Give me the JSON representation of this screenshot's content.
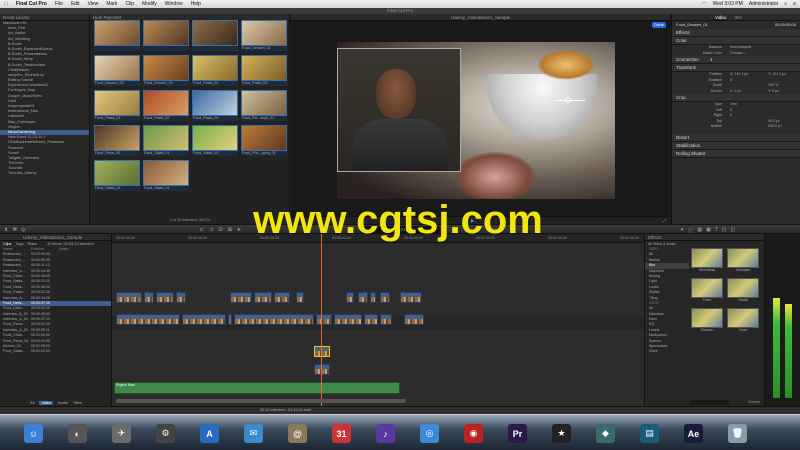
{
  "menubar": {
    "apple_icon": "apple-logo",
    "items": [
      "Final Cut Pro",
      "File",
      "Edit",
      "View",
      "Mark",
      "Clip",
      "Modify",
      "Window",
      "Help"
    ],
    "clock": "Wed 3:03 PM",
    "user": "Administrator"
  },
  "window": {
    "title": "Final Cut Pro"
  },
  "library": {
    "header": "Event Library",
    "items": [
      "Macintosh HD",
      "Alvin_Pett",
      "Art_Wallet",
      "Art_Wedding",
      "B-South",
      "B-South_ExpandedVideos",
      "B-South_Presentations",
      "B-South_Wrap",
      "B-South_Testimonials",
      "Chrafyfianes",
      "campfire_ShortsDrop",
      "Editing Tutorial",
      "ExperienceColumbus01",
      "FortHayes_Map",
      "Gospel_MusicVideo",
      "Hold",
      "Inappropriate01",
      "Instructional_Man",
      "LatitudeIt",
      "Map_FortHayes",
      "Meglen",
      "MicroGardening",
      "New Event 11-15-14-1",
      "OhioBusinessNetwork_Feedback",
      "Pewnoot",
      "Sonali",
      "Tailgate_Outreach",
      "TheDolor",
      "Tutorials",
      "Tutorials_Udemy"
    ],
    "selected_index": 21
  },
  "browser": {
    "header": "Hide Rejected",
    "status": "1 of 45 selected, 40:47s",
    "thumbs": [
      {
        "cap": "",
        "c1": "#c9a36b",
        "c2": "#6e4a2e"
      },
      {
        "cap": "",
        "c1": "#b98b54",
        "c2": "#523623"
      },
      {
        "cap": "",
        "c1": "#8f6d4a",
        "c2": "#3a2a1e"
      },
      {
        "cap": "Food_Dessert_01",
        "c1": "#d9c8a8",
        "c2": "#8a6a4a"
      },
      {
        "cap": "Food_Dessert_02",
        "c1": "#e2d3b5",
        "c2": "#9a7448"
      },
      {
        "cap": "Food_Dessert_03",
        "c1": "#c78a46",
        "c2": "#6a3f1e"
      },
      {
        "cap": "Food_Pasta_01",
        "c1": "#d8c06a",
        "c2": "#8a6a2a"
      },
      {
        "cap": "Food_Pasta_02",
        "c1": "#d4b25a",
        "c2": "#7a5e2a"
      },
      {
        "cap": "Food_Pasta_03",
        "c1": "#e0c880",
        "c2": "#a07a3a"
      },
      {
        "cap": "Food_Pasta_03",
        "c1": "#b04a2a",
        "c2": "#d9a060"
      },
      {
        "cap": "Food_Pasta_04",
        "c1": "#3a6aa0",
        "c2": "#c0d0e0"
      },
      {
        "cap": "Food_Piz...ough_01",
        "c1": "#d0c0a0",
        "c2": "#7a6040"
      },
      {
        "cap": "Food_Pizza_05",
        "c1": "#4a3a2a",
        "c2": "#d0a060"
      },
      {
        "cap": "Food_Salad_01",
        "c1": "#6a9a4a",
        "c2": "#d0c070"
      },
      {
        "cap": "Food_Salad_02",
        "c1": "#7ab04a",
        "c2": "#e0d080"
      },
      {
        "cap": "Food_Pho...ppng_01",
        "c1": "#c07a3a",
        "c2": "#5a3a20"
      },
      {
        "cap": "Food_Salad_03",
        "c1": "#a0b060",
        "c2": "#5a7030"
      },
      {
        "cap": "Food_Salad_04",
        "c1": "#8a5a3a",
        "c2": "#d0b080"
      }
    ]
  },
  "viewer": {
    "header": "Udemy_VideoBasics_Sample",
    "done_label": "Done",
    "zoom": "53%"
  },
  "inspector": {
    "clip_name": "Food_Dessert_01",
    "tabs": [
      "Video",
      "Info"
    ],
    "timecode": "00:00:00:00",
    "sections": {
      "effects": "Effects",
      "color": "Color",
      "connection": "Connection",
      "transform": "Transform",
      "crop": "Crop",
      "distort": "Distort",
      "stabilization": "Stabilization",
      "rolling_shutter": "Rolling Shutter"
    },
    "color_rows": [
      {
        "label": "Balance",
        "val": "Not Analyzed"
      },
      {
        "label": "Match Color",
        "val": "Choose..."
      }
    ],
    "transform_rows": [
      {
        "label": "Position",
        "val": "X: 140.1 px",
        "val2": "Y: 121.2 px"
      },
      {
        "label": "Rotation",
        "val": "0°"
      },
      {
        "label": "Scale",
        "val": "",
        "val2": "100 %"
      },
      {
        "label": "Anchor",
        "val": "X: 0 px",
        "val2": "Y: 0 px"
      }
    ],
    "crop_rows": [
      {
        "label": "Type",
        "val": "Trim"
      },
      {
        "label": "Left",
        "val": "0"
      },
      {
        "label": "Right",
        "val": "0"
      },
      {
        "label": "Top",
        "val": "",
        "val2": "00.0 px"
      },
      {
        "label": "Bottom",
        "val": "",
        "val2": "234.0 px"
      }
    ],
    "connection_val": "1"
  },
  "timeline": {
    "project_name": "Udemy_VideoBasics_Sample",
    "ruler": [
      "00:00:00:00",
      "00:00:15:00",
      "00:00:30:00",
      "00:00:45:00",
      "00:01:00:00",
      "00:01:15:00",
      "00:01:30:00",
      "00:01:45:00"
    ],
    "audio_label": "Rhythm Bass",
    "status": "00:12 selected - 01:42:04 total"
  },
  "index": {
    "tabs": [
      "Clips",
      "Tags",
      "Roles"
    ],
    "summary": "32 items, 00:03:13 selected",
    "col_name": "Name",
    "col_pos": "Position",
    "col_notes": "Notes",
    "rows": [
      {
        "name": "Restaurant_...",
        "pos": "00:00:00:00"
      },
      {
        "name": "Restaurant_...",
        "pos": "00:00:05:05"
      },
      {
        "name": "Restaurant_...",
        "pos": "00:00:11:12"
      },
      {
        "name": "Interview_A...",
        "pos": "00:00:14:09"
      },
      {
        "name": "Food_Chick...",
        "pos": "00:00:18:05"
      },
      {
        "name": "Food_Salad...",
        "pos": "00:00:23:10"
      },
      {
        "name": "Food_Dess...",
        "pos": "00:00:28:05"
      },
      {
        "name": "Food_Pasta...",
        "pos": "00:00:31:20"
      },
      {
        "name": "Interview_A...",
        "pos": "00:00:34:06"
      },
      {
        "name": "Food_Dess...",
        "pos": "00:00:37:15"
      },
      {
        "name": "Food_Dess...",
        "pos": "00:00:41:10"
      },
      {
        "name": "Interview_B_02",
        "pos": "00:00:45:00"
      },
      {
        "name": "Interview_A_03",
        "pos": "00:00:47:10"
      },
      {
        "name": "Food_Pizza...",
        "pos": "00:00:52:05"
      },
      {
        "name": "Interview_A_03",
        "pos": "00:00:55:11"
      },
      {
        "name": "Food_Chick...",
        "pos": "00:01:00:02"
      },
      {
        "name": "Food_Pizza_04",
        "pos": "00:01:04:05"
      },
      {
        "name": "Kitchen_01",
        "pos": "00:01:08:00"
      },
      {
        "name": "Food_Salad...",
        "pos": "00:01:12:00"
      }
    ],
    "selected_index": 9,
    "filter_tabs": [
      "All",
      "Video",
      "Audio",
      "Titles"
    ]
  },
  "effects": {
    "header": "Effects",
    "sub": "All Video & Audio",
    "categories": [
      "VIDEO",
      "All",
      "Basics",
      "Blur",
      "Distortion",
      "Keying",
      "Light",
      "Looks",
      "Stylize",
      "Tiling",
      "AUDIO",
      "All",
      "Distortion",
      "Echo",
      "EQ",
      "Levels",
      "Modulation",
      "Spaces",
      "Specialized",
      "Voice"
    ],
    "selected_index": 3,
    "items": [
      "Directional",
      "Gaussian",
      "Prism",
      "Radial",
      "Sharpen",
      "Zoom"
    ],
    "count": "6 items"
  },
  "dock": {
    "icons": [
      {
        "name": "finder",
        "bg": "#3c7fd6",
        "g": "☺"
      },
      {
        "name": "dashboard",
        "bg": "#555",
        "g": "◐"
      },
      {
        "name": "launchpad",
        "bg": "#6b6b6b",
        "g": "✈"
      },
      {
        "name": "system",
        "bg": "#444",
        "g": "⚙"
      },
      {
        "name": "app-store",
        "bg": "#2a6bc2",
        "g": "A"
      },
      {
        "name": "mail",
        "bg": "#3a8ad0",
        "g": "✉"
      },
      {
        "name": "contacts",
        "bg": "#8a7a5a",
        "g": "@"
      },
      {
        "name": "calendar",
        "bg": "#c33",
        "g": "31"
      },
      {
        "name": "itunes",
        "bg": "#5a3aa0",
        "g": "♪"
      },
      {
        "name": "safari",
        "bg": "#3a8ad8",
        "g": "◎"
      },
      {
        "name": "photo-booth",
        "bg": "#b22",
        "g": "◉"
      },
      {
        "name": "premiere",
        "bg": "#2a1a4a",
        "g": "Pr"
      },
      {
        "name": "final-cut",
        "bg": "#222",
        "g": "★"
      },
      {
        "name": "motion",
        "bg": "#3a6a6a",
        "g": "◆"
      },
      {
        "name": "compressor",
        "bg": "#1a5a7a",
        "g": "▤"
      },
      {
        "name": "after-effects",
        "bg": "#1a1a3a",
        "g": "Ae"
      },
      {
        "name": "trash",
        "bg": "#8a9aa8",
        "g": "🗑"
      }
    ]
  },
  "watermark": "www.cgtsj.com"
}
